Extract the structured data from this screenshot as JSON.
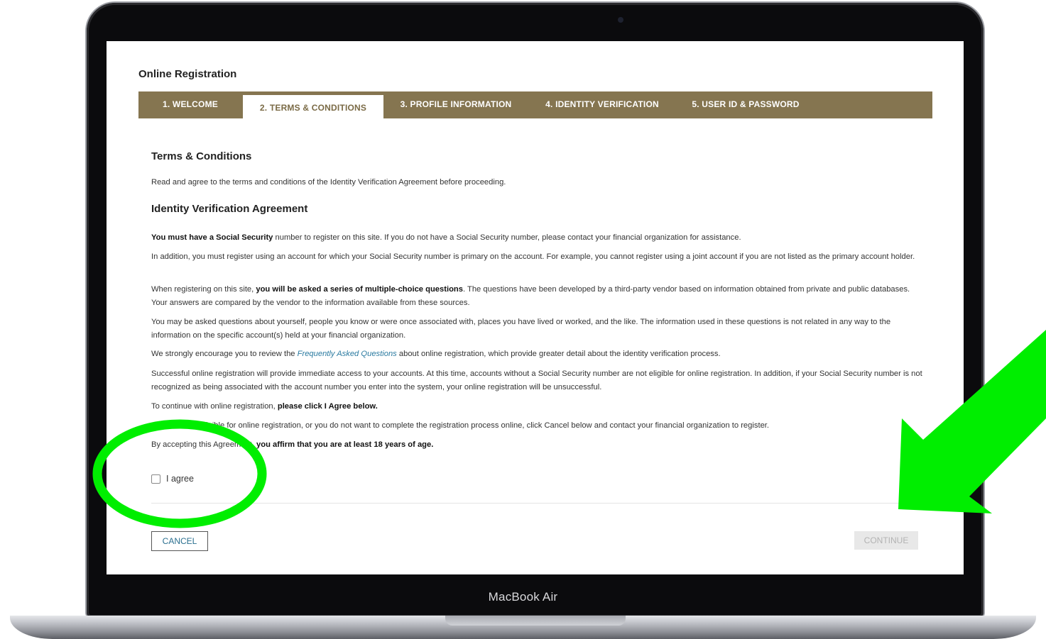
{
  "device": {
    "label": "MacBook Air"
  },
  "page": {
    "title": "Online Registration"
  },
  "tabs": [
    {
      "label": "1. WELCOME"
    },
    {
      "label": "2. TERMS & CONDITIONS"
    },
    {
      "label": "3. PROFILE INFORMATION"
    },
    {
      "label": "4. IDENTITY VERIFICATION"
    },
    {
      "label": "5. USER ID & PASSWORD"
    }
  ],
  "terms": {
    "heading": "Terms & Conditions",
    "intro": "Read and agree to the terms and conditions of the Identity Verification Agreement before proceeding.",
    "agreement_heading": "Identity Verification Agreement",
    "p1_bold": "You must have a Social Security",
    "p1_rest": " number to register on this site. If you do not have a Social Security number, please contact your financial organization for assistance.",
    "p2": "In addition, you must register using an account for which your Social Security number is primary on the account. For example, you cannot register using a joint account if you are not listed as the primary account holder.",
    "p3_a": "When registering on this site, ",
    "p3_bold": "you will be asked a series of multiple-choice questions",
    "p3_b": ". The questions have been developed by a third-party vendor based on information obtained from private and public databases. Your answers are compared by the vendor to the information available from these sources.",
    "p4": "You may be asked questions about yourself, people you know or were once associated with, places you have lived or worked, and the like. The information used in these questions is not related in any way to the information on the specific account(s) held at your financial organization.",
    "p5_a": "We strongly encourage you to review the ",
    "p5_link": "Frequently Asked Questions",
    "p5_b": " about online registration, which provide greater detail about the identity verification process.",
    "p6": "Successful online registration will provide immediate access to your accounts. At this time, accounts without a Social Security number are not eligible for online registration. In addition, if your Social Security number is not recognized as being associated with the account number you enter into the system, your online registration will be unsuccessful.",
    "p7_a": "To continue with online registration, ",
    "p7_bold": "please click I Agree below.",
    "p8": "If you are not eligible for online registration, or you do not want to complete the registration process online, click Cancel below and contact your financial organization to register.",
    "p9_a": "By accepting this Agreement, ",
    "p9_bold": "you affirm that you are at least 18 years of age."
  },
  "agree": {
    "label": "I agree",
    "checked": false
  },
  "buttons": {
    "cancel": "CANCEL",
    "continue": "CONTINUE"
  },
  "colors": {
    "tab_bar": "#857550",
    "highlight_green": "#00ee00"
  }
}
